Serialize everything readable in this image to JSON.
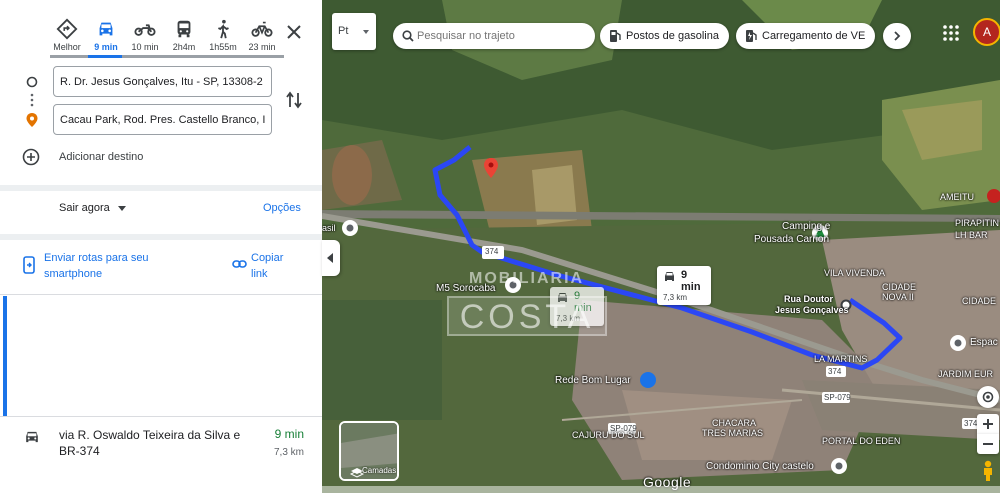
{
  "travel_modes": [
    {
      "name": "best",
      "label": "Melhor"
    },
    {
      "name": "car",
      "label": "9 min"
    },
    {
      "name": "motorcycle",
      "label": "10 min"
    },
    {
      "name": "transit",
      "label": "2h4m"
    },
    {
      "name": "walk",
      "label": "1h55m"
    },
    {
      "name": "bike",
      "label": "23 min"
    }
  ],
  "active_mode": "car",
  "directions": {
    "origin": "R. Dr. Jesus Gonçalves, Itu - SP, 13308-2",
    "destination": "Cacau Park, Rod. Pres. Castello Branco, I",
    "add_destination": "Adicionar destino",
    "depart_label": "Sair agora",
    "options_label": "Opções",
    "send_to_phone": "Enviar rotas para seu smartphone",
    "copy_link": "Copiar link"
  },
  "route": {
    "name": "via R. Oswaldo Teixeira da Silva e BR-374",
    "time": "9 min",
    "distance": "7,3 km"
  },
  "map": {
    "lang_label": "Pt",
    "search_placeholder": "Pesquisar no trajeto",
    "chips": [
      "Postos de gasolina",
      "Carregamento de VE"
    ],
    "avatar_letter": "A",
    "route_box": {
      "time": "9 min",
      "distance": "7,3 km"
    },
    "alt_box": {
      "time": "9 min",
      "distance": "7,3 km"
    },
    "labels": {
      "camping_1": "Camping e",
      "camping_2": "Pousada Carrion",
      "ameitu": "AMEITU",
      "pirapitin": "PIRAPITIN",
      "lh_bar": "LH BAR",
      "vila_vivenda": "VILA VIVENDA",
      "cidade_1": "CIDADE",
      "cidade_2": "NOVA II",
      "cidade_3": "CIDADE",
      "rua_1": "Rua Doutor",
      "rua_2": "Jesus Gonçalves",
      "m5": "M5 Sorocaba",
      "la_martins": "LA MARTINS",
      "rede": "Rede Bom Lugar",
      "chacara_1": "CHACARA",
      "chacara_2": "TRES MARIAS",
      "cajuru": "CAJURU DO SUL",
      "portal": "PORTAL DO EDEN",
      "condominio": "Condominio City castelo",
      "espac": "Espac",
      "jardim": "JARDIM EUR",
      "brasil": "asil",
      "r374a": "374",
      "r374b": "374",
      "sp079": "SP-079",
      "sp079b": "SP-079",
      "r374c": "374"
    },
    "watermark_1": "MOBILIARIA",
    "watermark_2": "COSTA",
    "layers_label": "Camadas",
    "google": "Google"
  },
  "colors": {
    "route_blue": "#2b47f5",
    "accent": "#1a73e8",
    "green_time": "#188038"
  }
}
